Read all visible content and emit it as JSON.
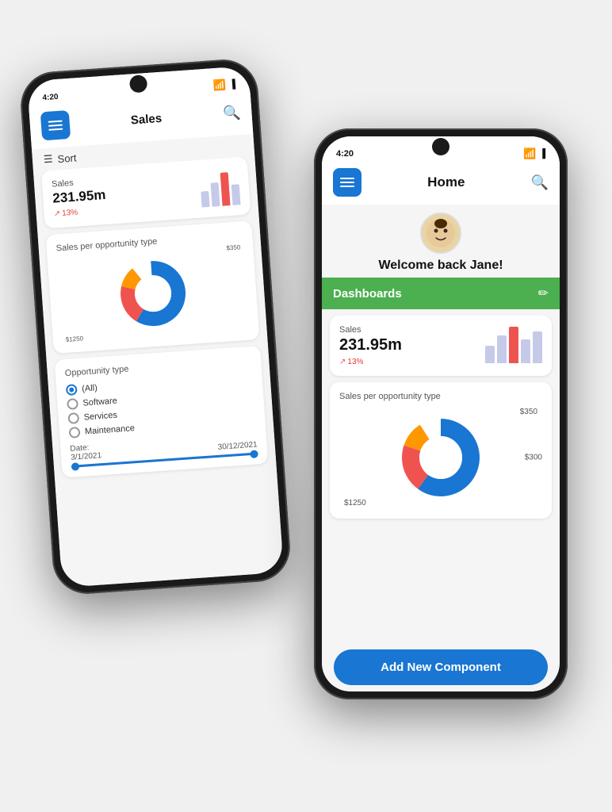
{
  "back_phone": {
    "status": {
      "time": "4:20",
      "wifi": "📶",
      "battery": "🔋"
    },
    "title": "Sales",
    "sort_label": "Sort",
    "sales_card": {
      "label": "Sales",
      "value": "231.95m",
      "trend": "13%"
    },
    "pie_card": {
      "label": "Sales per opportunity type",
      "label_350": "$350",
      "label_1250": "$1250"
    },
    "opp_card": {
      "label": "Opportunity type",
      "options": [
        "(All)",
        "Software",
        "Services",
        "Maintenance"
      ],
      "checked_index": 0,
      "date_label": "Date:",
      "date_from": "3/1/2021",
      "date_to": "30/12/2021"
    }
  },
  "front_phone": {
    "status": {
      "time": "4:20",
      "wifi": "📶",
      "battery": "🔋"
    },
    "title": "Home",
    "avatar_emoji": "🧑",
    "welcome_text": "Welcome back Jane!",
    "dashboards_label": "Dashboards",
    "sales_card": {
      "label": "Sales",
      "value": "231.95m",
      "trend": "13%"
    },
    "pie_card": {
      "label": "Sales per opportunity type",
      "label_350": "$350",
      "label_300": "$300",
      "label_1250": "$1250"
    },
    "add_button": "Add New Component"
  }
}
